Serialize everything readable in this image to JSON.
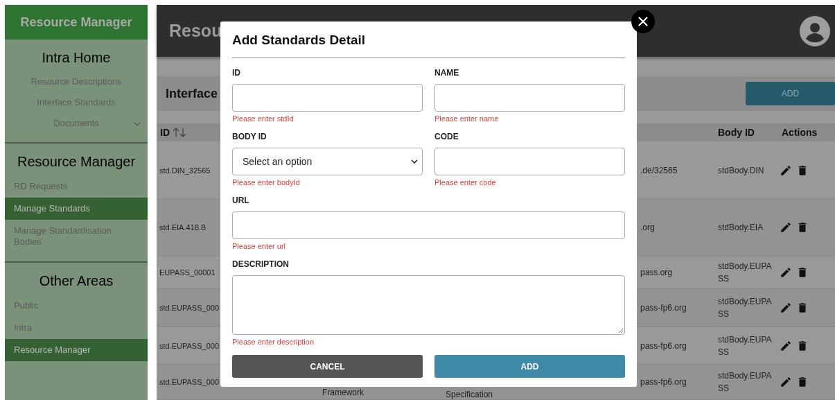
{
  "sidebar": {
    "title": "Resource Manager",
    "sections": [
      {
        "heading": "Intra Home",
        "items": [
          {
            "label": "Resource Descriptions",
            "kind": "link",
            "selected": false
          },
          {
            "label": "Interface Standards",
            "kind": "link",
            "selected": false
          },
          {
            "label": "Documents",
            "kind": "dropdown",
            "selected": false
          }
        ]
      },
      {
        "heading": "Resource Manager",
        "items": [
          {
            "label": "RD Requests",
            "kind": "link",
            "selected": false
          },
          {
            "label": "Manage Standards",
            "kind": "link",
            "selected": true
          },
          {
            "label": "Manage Standardisation Bodies",
            "kind": "link",
            "selected": false
          }
        ]
      },
      {
        "heading": "Other Areas",
        "items": [
          {
            "label": "Public",
            "kind": "link",
            "selected": false
          },
          {
            "label": "Intra",
            "kind": "link",
            "selected": false
          },
          {
            "label": "Resource Manager",
            "kind": "link",
            "selected": true
          }
        ]
      }
    ]
  },
  "header": {
    "title": "Resou"
  },
  "toolbar": {
    "title": "Interface",
    "add_button": "ADD"
  },
  "table": {
    "columns": {
      "id": "ID",
      "body_id": "Body ID",
      "actions": "Actions"
    },
    "rows": [
      {
        "id": "std.DIN_32565",
        "url": ".de/32565",
        "body_id": "stdBody.DIN"
      },
      {
        "id": "std.EIA.418.B",
        "url": ".org",
        "body_id": "stdBody.EIA"
      },
      {
        "id": "EUPASS_00001",
        "url": "pass.org",
        "body_id": "stdBody.EUPASS"
      },
      {
        "id": "std.EUPASS_000",
        "url": "pass-fp6.org",
        "body_id": "stdBody.EUPASS"
      },
      {
        "id": "std.EUPASS_000",
        "url": "pass-fp6.org",
        "body_id": "stdBody.EUPASS"
      },
      {
        "id": "std.EUPASS_000",
        "column_2": "Framework",
        "column_3": "Specification",
        "url": "pass-fp6.org",
        "body_id": "stdBody.EUPASS"
      }
    ]
  },
  "dialog": {
    "title": "Add Standards Detail",
    "field_rows": [
      [
        {
          "label": "ID",
          "kind": "text",
          "error": "Please enter stdId"
        },
        {
          "label": "NAME",
          "kind": "text",
          "error": "Please enter name"
        }
      ],
      [
        {
          "label": "BODY ID",
          "kind": "select",
          "value": "Select an option",
          "error": "Please enter bodyId"
        },
        {
          "label": "CODE",
          "kind": "text",
          "error": "Please enter code"
        }
      ],
      [
        {
          "label": "URL",
          "kind": "text",
          "error": "Please enter url"
        }
      ],
      [
        {
          "label": "DESCRIPTION",
          "kind": "textarea",
          "error": "Please enter description"
        }
      ]
    ],
    "buttons": [
      {
        "label": "CANCEL",
        "kind": "cancel"
      },
      {
        "label": "ADD",
        "kind": "submit"
      }
    ]
  }
}
